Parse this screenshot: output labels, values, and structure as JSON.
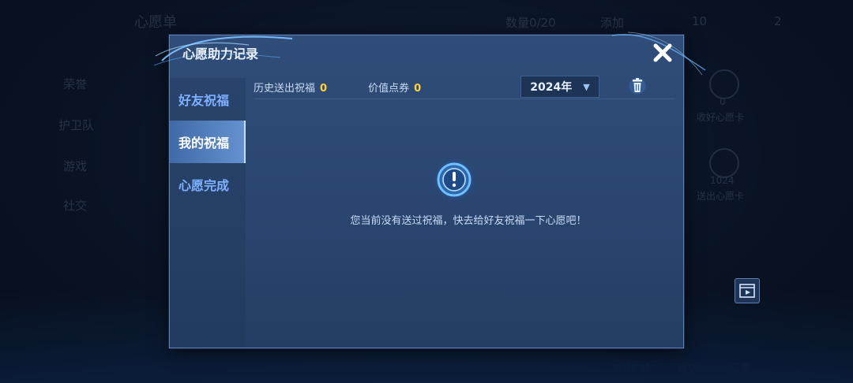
{
  "background": {
    "top_title": "心愿单",
    "count_label": "数量0/20",
    "add_label": "添加",
    "coin_value": "10",
    "coupon_value": "2",
    "left_menu": [
      "荣誉",
      "护卫队",
      "游戏",
      "社交"
    ],
    "friend_wish_count": "0",
    "friend_wish_label": "收好心愿卡",
    "sent_wish_count": "1024",
    "sent_wish_label": "送出心愿卡",
    "bottom_items": [
      "祝福广场",
      "分享",
      "设置"
    ]
  },
  "modal": {
    "title": "心愿助力记录",
    "tabs": [
      {
        "label": "好友祝福",
        "active": false
      },
      {
        "label": "我的祝福",
        "active": true
      },
      {
        "label": "心愿完成",
        "active": false
      }
    ],
    "history_label": "历史送出祝福",
    "history_value": "0",
    "value_label": "价值点券",
    "value_value": "0",
    "year": "2024年",
    "empty_message": "您当前没有送过祝福，快去给好友祝福一下心愿吧！"
  },
  "colors": {
    "accent": "#ffd23a",
    "tab_active_bg": "#6591d0",
    "tab_text": "#7fb0ff"
  },
  "icons": {
    "close": "close-icon",
    "trash": "trash-icon",
    "dropdown": "chevron-down-icon",
    "empty": "exclamation-icon",
    "replay": "play-icon"
  }
}
